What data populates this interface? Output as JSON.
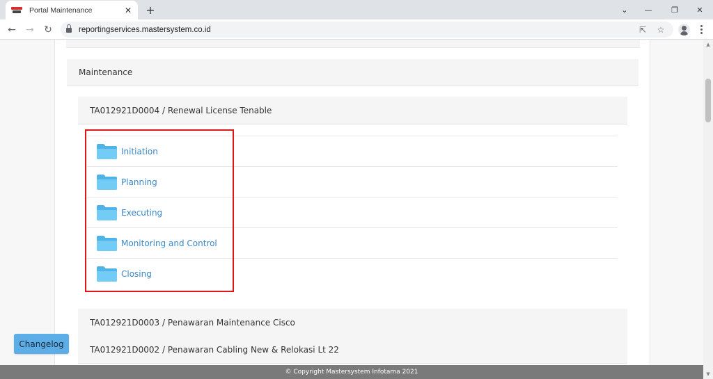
{
  "browser": {
    "tab_title": "Portal Maintenance",
    "tab_close": "✕",
    "new_tab": "+",
    "url": "reportingservices.mastersystem.co.id",
    "controls": {
      "minimize": "⌄",
      "min": "—",
      "restore": "❐",
      "close": "✕"
    },
    "nav": {
      "back": "←",
      "forward": "→",
      "reload": "↻"
    },
    "omni_icons": {
      "share": "⇱",
      "bookmark": "☆"
    }
  },
  "page": {
    "section_title": "Maintenance",
    "projects": [
      {
        "title": "TA012921D0004 / Renewal License Tenable"
      },
      {
        "title": "TA012921D0003 / Penawaran Maintenance Cisco"
      },
      {
        "title": "TA012921D0002 / Penawaran Cabling New & Relokasi Lt 22"
      }
    ],
    "folders": [
      {
        "label": "Initiation",
        "icon": "folder-icon"
      },
      {
        "label": "Planning",
        "icon": "folder-icon"
      },
      {
        "label": "Executing",
        "icon": "folder-icon"
      },
      {
        "label": "Monitoring and Control",
        "icon": "folder-icon"
      },
      {
        "label": "Closing",
        "icon": "folder-icon"
      }
    ],
    "changelog_label": "Changelog",
    "footer_text": "© Copyright Mastersystem Infotama 2021"
  },
  "colors": {
    "link": "#3a87c8",
    "highlight": "#e01515",
    "changelog_bg": "#5dade6",
    "footer_bg": "#7a7a7a"
  }
}
